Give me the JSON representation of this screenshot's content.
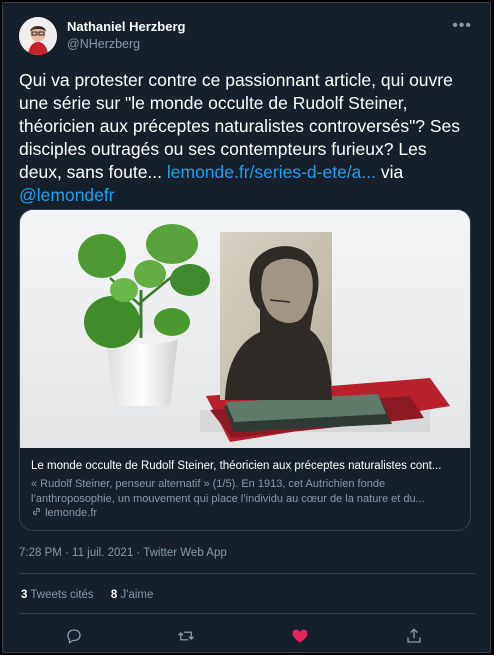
{
  "author": {
    "name": "Nathaniel Herzberg",
    "handle": "@NHerzberg"
  },
  "tweet": {
    "text_main": "Qui va protester contre ce passionnant article, qui ouvre une série sur \"le monde occulte de Rudolf Steiner, théoricien aux préceptes naturalistes controversés\"? Ses disciples outragés ou ses contempteurs furieux? Les deux, sans foute... ",
    "link": "lemonde.fr/series-d-ete/a...",
    "via": " via ",
    "mention": "@lemondefr"
  },
  "preview": {
    "title": "Le monde occulte de Rudolf Steiner, théoricien aux préceptes naturalistes cont...",
    "description": "« Rudolf Steiner, penseur alternatif » (1/5). En 1913, cet Autrichien fonde l’anthroposophie, un mouvement qui place l’individu au cœur de la nature et du...",
    "domain": "lemonde.fr"
  },
  "meta": "7:28 PM · 11 juil. 2021 · Twitter Web App",
  "stats": {
    "retweets_count": "3",
    "retweets_label": " Tweets cités",
    "likes_count": "8",
    "likes_label": " J'aime"
  },
  "icons": {
    "more": "more-icon",
    "reply": "reply-icon",
    "retweet": "retweet-icon",
    "like": "heart-icon",
    "share": "share-icon",
    "link": "link-icon"
  },
  "colors": {
    "background": "#15202b",
    "link": "#1da1f2",
    "like": "#e0245e",
    "muted": "#8899a6"
  }
}
